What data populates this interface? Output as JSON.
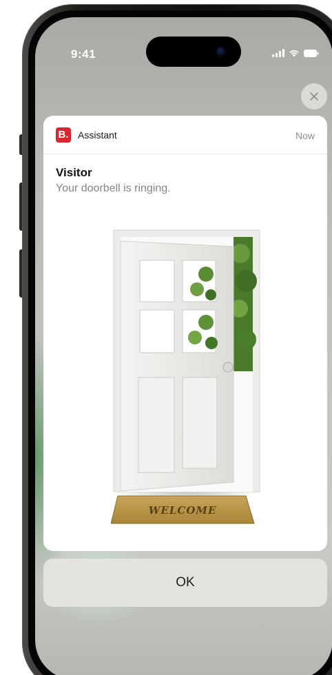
{
  "status_bar": {
    "time": "9:41"
  },
  "notification": {
    "app_name": "Assistant",
    "app_icon_letter": "B.",
    "timestamp": "Now",
    "title": "Visitor",
    "body": "Your doorbell is ringing.",
    "illustration": {
      "mat_text": "WELCOME"
    }
  },
  "actions": {
    "ok_label": "OK"
  },
  "colors": {
    "app_icon_bg": "#d8262e",
    "card_bg": "#ffffff",
    "button_bg": "#e2e3df"
  },
  "icons": {
    "close": "close-icon",
    "signal": "cellular-signal-icon",
    "wifi": "wifi-icon",
    "battery": "battery-icon"
  }
}
